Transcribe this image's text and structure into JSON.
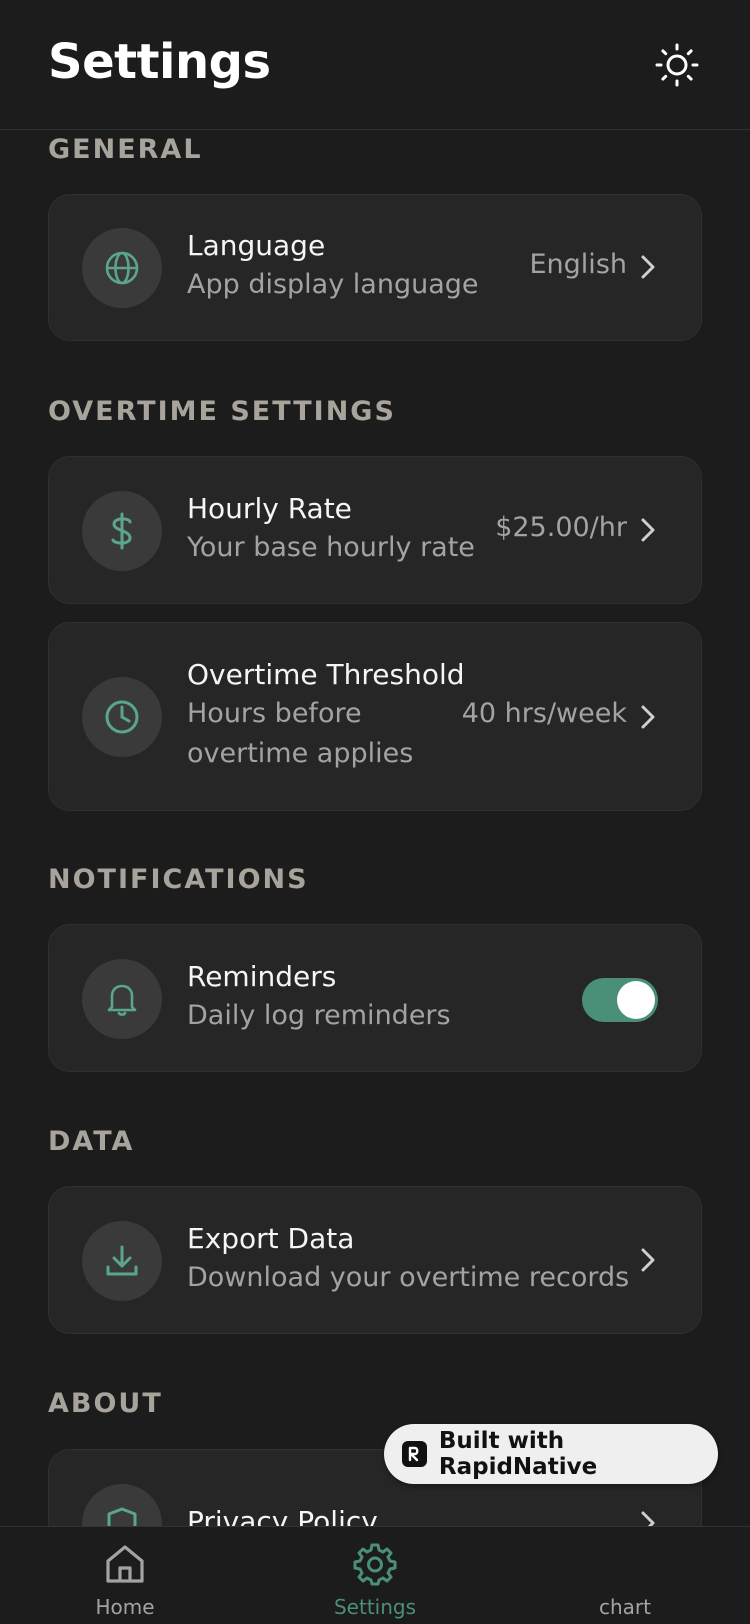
{
  "header": {
    "title": "Settings",
    "theme_icon": "sun-icon"
  },
  "sections": {
    "general": {
      "title": "GENERAL",
      "language": {
        "icon": "globe-icon",
        "title": "Language",
        "subtitle": "App display language",
        "value": "English"
      }
    },
    "overtime": {
      "title": "OVERTIME SETTINGS",
      "hourly_rate": {
        "icon": "dollar-icon",
        "title": "Hourly Rate",
        "subtitle": "Your base hourly rate",
        "value": "$25.00/hr"
      },
      "threshold": {
        "icon": "clock-icon",
        "title": "Overtime Threshold",
        "subtitle_line1": "Hours before",
        "subtitle_line2": "overtime applies",
        "value": "40 hrs/week"
      }
    },
    "notifications": {
      "title": "NOTIFICATIONS",
      "reminders": {
        "icon": "bell-icon",
        "title": "Reminders",
        "subtitle": "Daily log reminders",
        "enabled": true
      }
    },
    "data": {
      "title": "DATA",
      "export": {
        "icon": "download-icon",
        "title": "Export Data",
        "subtitle": "Download your overtime records"
      }
    },
    "about": {
      "title": "ABOUT",
      "privacy": {
        "icon": "shield-icon",
        "title": "Privacy Policy"
      }
    }
  },
  "badge": {
    "text": "Built with RapidNative"
  },
  "tabs": [
    {
      "label": "Home",
      "icon": "home-icon",
      "active": false
    },
    {
      "label": "Settings",
      "icon": "gear-icon",
      "active": true
    },
    {
      "label": "chart",
      "icon": "chart-icon",
      "active": false
    }
  ],
  "colors": {
    "accent": "#4a9078",
    "background": "#1c1c1c",
    "card": "#262626",
    "muted": "#a3a3a3"
  }
}
